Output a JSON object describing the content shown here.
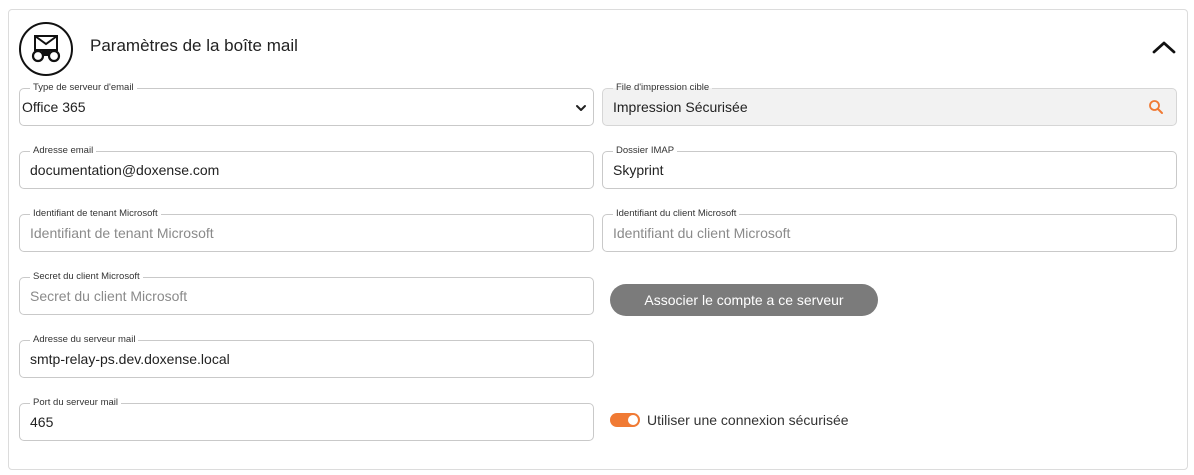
{
  "header": {
    "title": "Paramètres de la boîte mail"
  },
  "fields": {
    "server_type": {
      "legend": "Type de serveur d'email",
      "value": "Office 365"
    },
    "print_queue": {
      "legend": "File d'impression cible",
      "value": "Impression Sécurisée"
    },
    "email": {
      "legend": "Adresse email",
      "value": "documentation@doxense.com"
    },
    "imap_folder": {
      "legend": "Dossier IMAP",
      "value": "Skyprint"
    },
    "tenant_id": {
      "legend": "Identifiant de tenant Microsoft",
      "value": "",
      "placeholder": "Identifiant de tenant Microsoft"
    },
    "client_id": {
      "legend": "Identifiant du client Microsoft",
      "value": "",
      "placeholder": "Identifiant du client Microsoft"
    },
    "client_secret": {
      "legend": "Secret du client Microsoft",
      "value": "",
      "placeholder": "Secret du client Microsoft"
    },
    "server_address": {
      "legend": "Adresse du serveur mail",
      "value": "smtp-relay-ps.dev.doxense.local"
    },
    "server_port": {
      "legend": "Port du serveur mail",
      "value": "465"
    }
  },
  "associate_button": {
    "label": "Associer le compte a ce serveur"
  },
  "secure_connection": {
    "label": "Utiliser une connexion sécurisée",
    "enabled": true
  },
  "colors": {
    "accent": "#f07a34",
    "button_gray": "#7b7b7b"
  },
  "icons": {
    "header": "mail-binoculars-icon",
    "collapse": "chevron-up-icon",
    "search": "search-icon",
    "select": "chevron-down-icon"
  }
}
